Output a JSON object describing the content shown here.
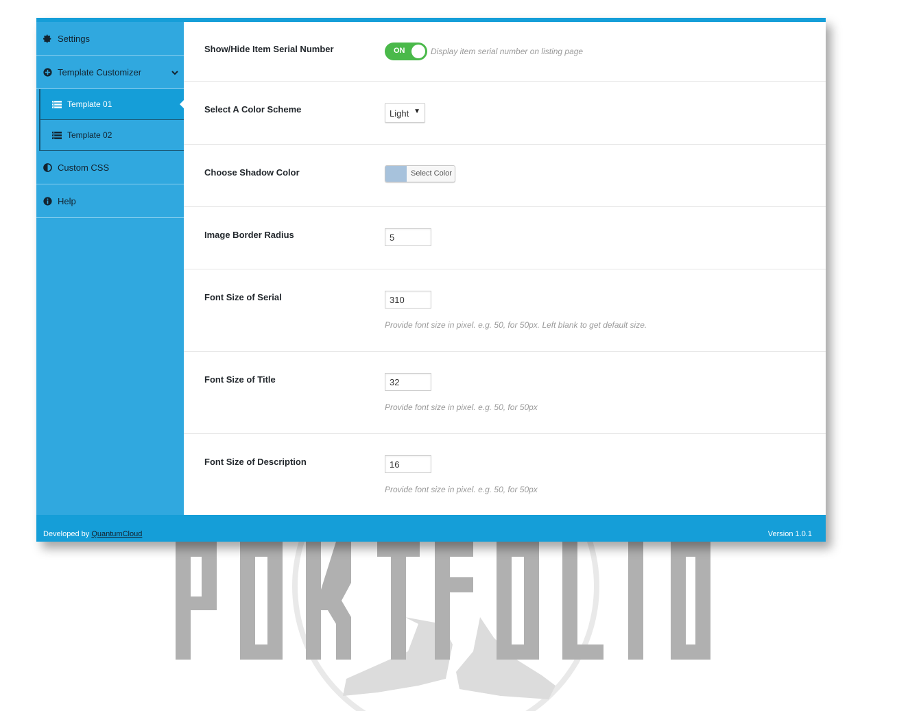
{
  "sidebar": {
    "items": [
      {
        "label": "Settings",
        "icon": "gear-icon"
      },
      {
        "label": "Template Customizer",
        "icon": "plus-circle-icon"
      },
      {
        "label": "Custom CSS",
        "icon": "contrast-icon"
      },
      {
        "label": "Help",
        "icon": "info-icon"
      }
    ],
    "subitems": [
      {
        "label": "Template 01",
        "icon": "list-icon",
        "active": true
      },
      {
        "label": "Template 02",
        "icon": "list-icon",
        "active": false
      }
    ]
  },
  "settings": {
    "serial": {
      "label": "Show/Hide Item Serial Number",
      "toggle": "ON",
      "desc": "Display item serial number on listing page"
    },
    "scheme": {
      "label": "Select A Color Scheme",
      "value": "Light"
    },
    "shadow": {
      "label": "Choose Shadow Color",
      "button": "Select Color",
      "color": "#a7c2dc"
    },
    "radius": {
      "label": "Image Border Radius",
      "value": "5"
    },
    "serial_size": {
      "label": "Font Size of Serial",
      "value": "310",
      "desc": "Provide font size in pixel. e.g. 50, for 50px. Left blank to get default size."
    },
    "title_size": {
      "label": "Font Size of Title",
      "value": "32",
      "desc": "Provide font size in pixel. e.g. 50, for 50px"
    },
    "desc_size": {
      "label": "Font Size of Description",
      "value": "16",
      "desc": "Provide font size in pixel. e.g. 50, for 50px"
    }
  },
  "footer": {
    "developed_by": "Developed by",
    "link": "QuantumCloud",
    "version": "Version 1.0.1"
  },
  "colors": {
    "accent": "#159ed8",
    "sidebar": "#30a8df",
    "toggle_on": "#4ab94a"
  }
}
